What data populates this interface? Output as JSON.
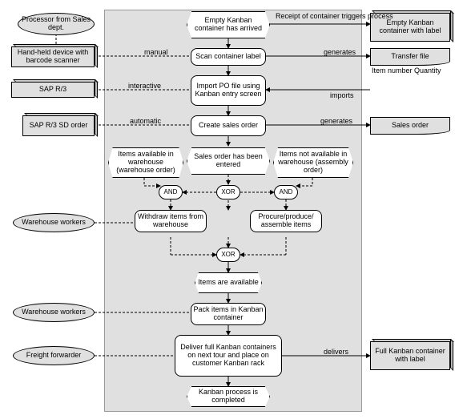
{
  "diagram": {
    "events": {
      "start": "Empty Kanban container has arrived",
      "soEntered": "Sales order has been entered",
      "itemsAvail": "Items are available",
      "end": "Kanban process is completed",
      "availWh": "Items available in warehouse (warehouse order)",
      "notAvailWh": "Items not available in warehouse (assembly order)"
    },
    "functions": {
      "scan": "Scan container label",
      "importPO": "Import PO file using Kanban entry screen",
      "createSO": "Create sales order",
      "withdraw": "Withdraw items from warehouse",
      "procure": "Procure/produce/ assemble items",
      "pack": "Pack items in Kanban container",
      "deliver": "Deliver full Kanban containers on next tour and place on customer Kanban rack"
    },
    "gates": {
      "and1": "AND",
      "xor1": "XOR",
      "and2": "AND",
      "xor2": "XOR"
    },
    "orgs": {
      "processor": "Processor from Sales dept.",
      "wh1": "Warehouse workers",
      "wh2": "Warehouse workers",
      "freight": "Freight forwarder"
    },
    "systems": {
      "handheld": "Hand-held device with barcode scanner",
      "sapr3": "SAP R/3",
      "sapsd": "SAP R/3 SD order"
    },
    "dataobjects": {
      "emptyContainer": "Empty Kanban container with label",
      "transferFile": "Transfer file",
      "transferFileDetail": "Item number Quantity",
      "salesOrder": "Sales order",
      "fullContainer": "Full Kanban container with label"
    },
    "edgelabels": {
      "receiptTriggers": "Receipt of container triggers process",
      "manual": "manual",
      "interactive": "interactive",
      "automatic": "automatic",
      "generates1": "generates",
      "imports": "imports",
      "generates2": "generates",
      "delivers": "delivers"
    }
  }
}
